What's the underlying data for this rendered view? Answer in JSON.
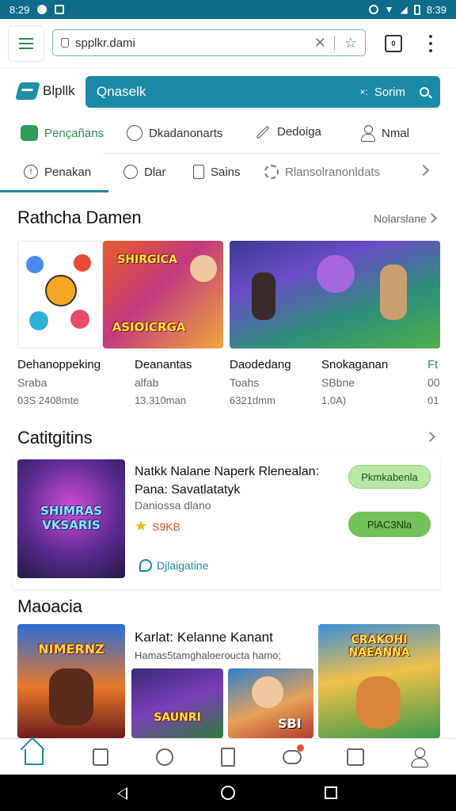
{
  "status_bar": {
    "time_left": "8:29",
    "time_right": "8:39"
  },
  "browser": {
    "url": "spplkr.dami",
    "tabs_count": "0"
  },
  "app": {
    "logo": "Blpllk",
    "search": {
      "placeholder": "Qnaselk",
      "clear": "×:",
      "button": "Sorim"
    }
  },
  "categories": [
    {
      "label": "Pençañans",
      "icon": "chat-icon",
      "active": true
    },
    {
      "label": "Dkadanonarts",
      "icon": "clock-icon"
    },
    {
      "label": "Dedoiga",
      "icon": "pen-icon"
    },
    {
      "label": "Nmal",
      "icon": "person-icon"
    }
  ],
  "sub_tabs": [
    {
      "label": "Penakan",
      "icon": "info-icon",
      "active": true
    },
    {
      "label": "Dlar",
      "icon": "coin-icon"
    },
    {
      "label": "Sains",
      "icon": "document-icon"
    },
    {
      "label": "Rlansolranonldats",
      "icon": "gear-icon"
    }
  ],
  "section1": {
    "title": "Rathcha Damen",
    "more": "Nolarslane",
    "games": [
      {
        "title": "Dehanoppeking",
        "sub": "Sraba",
        "size": "03S 2408mte"
      },
      {
        "title": "Deanantas",
        "sub": "alfab",
        "size": "13.310man"
      },
      {
        "title": "Daodedang",
        "sub": "Toahs",
        "size": "6321dmm"
      },
      {
        "title": "Snokaganan",
        "sub": "SBbne",
        "size": "1,0A)"
      },
      {
        "title": "Ft",
        "sub": "00",
        "size": "01"
      }
    ],
    "art": {
      "card2": "ASIOICRGA",
      "card2_top": "SHIRGICA"
    }
  },
  "section2": {
    "title": "Catitgitins",
    "featured": {
      "title": "Natkk Nalane Naperk Rlenealan: Pana: Savatlatatyk",
      "sub": "Daniossa dlano",
      "rating": "S9KB",
      "link": "Djlaigatine",
      "btn1": "Pkmkabenla",
      "btn2": "PlAC3Nla",
      "art": "SHIMRAS VKSARIS"
    }
  },
  "section3": {
    "title": "Maoacia",
    "card_title": "Karlat: Kelanne Kanant",
    "card_sub": "Hamas5tamghaloeroucta hamo;",
    "art1": "NIMERNZ",
    "art2": "SAUNRI",
    "art3": "SBI",
    "art4": "CRAKOHI NAEANNA"
  },
  "colors": {
    "accent": "#1a8aa6",
    "green": "#2f8a50",
    "status_bar": "#0f6b8a"
  }
}
